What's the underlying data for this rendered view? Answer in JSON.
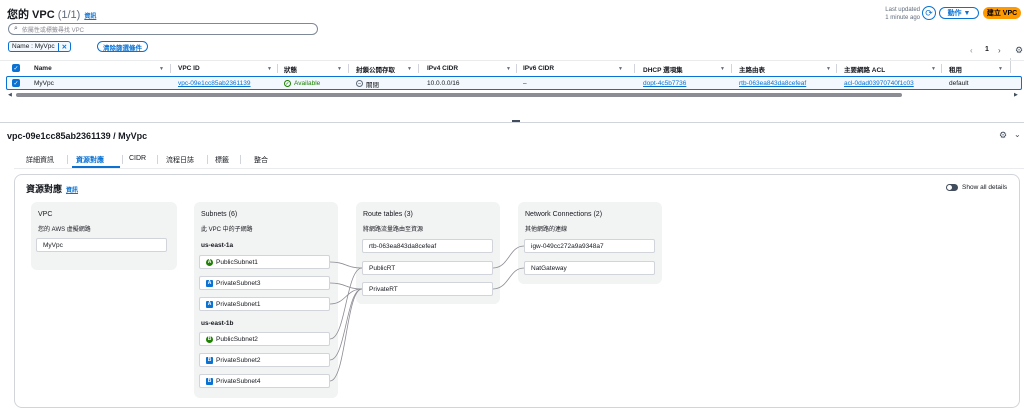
{
  "header": {
    "title": "您的 VPC",
    "count": "(1/1)",
    "info_link": "資訊",
    "last_updated_label": "Last updated",
    "last_updated_value": "1 minute ago",
    "actions_label": "動作 ▼",
    "create_label": "建立 VPC"
  },
  "search": {
    "placeholder": "依屬性或標籤尋找 VPC"
  },
  "filter": {
    "token_label": "Name : MyVpc",
    "clear_label": "清除篩選條件"
  },
  "pagination": {
    "prev": "‹",
    "page": "1",
    "next": "›"
  },
  "table": {
    "headers": [
      "Name",
      "VPC ID",
      "狀態",
      "封鎖公開存取",
      "IPv4 CIDR",
      "IPv6 CIDR",
      "DHCP 選項集",
      "主路由表",
      "主要網路 ACL",
      "租用"
    ],
    "row": {
      "name": "MyVpc",
      "vpc_id": "vpc-09e1cc85ab2361139",
      "state": "Available",
      "block_public_access": "關閉",
      "ipv4_cidr": "10.0.0.0/16",
      "ipv6_cidr": "–",
      "dhcp": "dopt-4c5b7736",
      "main_route_table": "rtb-063ea843da8cefeaf",
      "main_acl": "acl-0dad03970740f1c03",
      "tenancy": "default"
    }
  },
  "detail": {
    "title": "vpc-09e1cc85ab2361139 / MyVpc",
    "tabs": [
      "詳細資訊",
      "資源對應",
      "CIDR",
      "流程日誌",
      "標籤",
      "整合"
    ],
    "active_tab": "資源對應"
  },
  "resource_map": {
    "title": "資源對應",
    "info_link": "資訊",
    "show_all_label": "Show all details",
    "vpc": {
      "title": "VPC",
      "subtitle": "您的 AWS 虛擬網路",
      "name": "MyVpc"
    },
    "subnets": {
      "title": "Subnets (6)",
      "subtitle": "此 VPC 中的子網路",
      "zone_a": "us-east-1a",
      "zone_b": "us-east-1b",
      "zone_a_items": [
        {
          "name": "PublicSubnet1",
          "badge": "A"
        },
        {
          "name": "PrivateSubnet3",
          "badge": "A"
        },
        {
          "name": "PrivateSubnet1",
          "badge": "A"
        }
      ],
      "zone_b_items": [
        {
          "name": "PublicSubnet2",
          "badge": "B"
        },
        {
          "name": "PrivateSubnet2",
          "badge": "B"
        },
        {
          "name": "PrivateSubnet4",
          "badge": "B"
        }
      ]
    },
    "route_tables": {
      "title": "Route tables (3)",
      "subtitle": "將網路流量路由至資源",
      "items": [
        "rtb-063ea843da8cefeaf",
        "PublicRT",
        "PrivateRT"
      ]
    },
    "network_connections": {
      "title": "Network Connections (2)",
      "subtitle": "其他網路的連線",
      "items": [
        "igw-049cc272a9a9348a7",
        "NatGateway"
      ]
    }
  },
  "colors": {
    "accent": "#0972d3",
    "orange": "#ff9900",
    "green": "#1d8102"
  }
}
